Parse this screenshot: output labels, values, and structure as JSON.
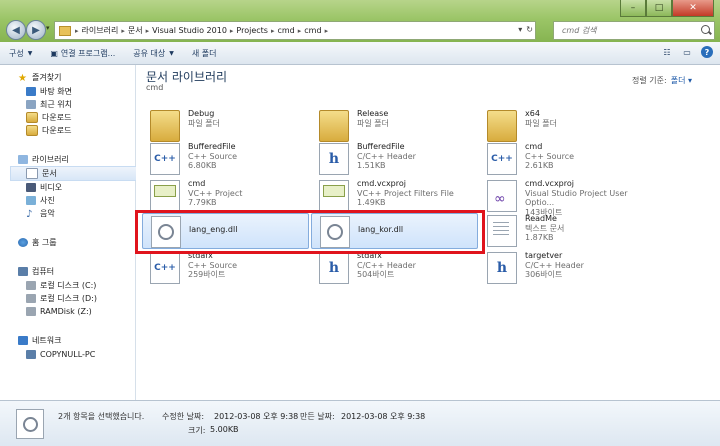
{
  "window": {
    "controls": {
      "minimize": "–",
      "maximize": "□",
      "close": "✕"
    }
  },
  "address": {
    "crumbs": [
      "라이브러리",
      "문서",
      "Visual Studio 2010",
      "Projects",
      "cmd",
      "cmd"
    ],
    "search_placeholder": "cmd 검색"
  },
  "toolbar": {
    "organize": "구성",
    "open_program": "연결 프로그램...",
    "share": "공유 대상",
    "new_folder": "새 폴더"
  },
  "sidebar": {
    "favorites": "즐겨찾기",
    "desktop": "바탕 화면",
    "recent": "최근 위치",
    "downloads1": "다운로드",
    "downloads2": "다운로드",
    "libraries": "라이브러리",
    "documents": "문서",
    "videos": "비디오",
    "pictures": "사진",
    "music": "음악",
    "homegroup": "홈 그룹",
    "computer": "컴퓨터",
    "disk_c": "로컬 디스크 (C:)",
    "disk_d": "로컬 디스크 (D:)",
    "ramdisk": "RAMDisk (Z:)",
    "network": "네트워크",
    "pc": "COPYNULL-PC"
  },
  "content": {
    "title": "문서 라이브러리",
    "subtitle": "cmd",
    "arrange_label": "정렬 기준:",
    "arrange_value": "폴더 ▾",
    "files": [
      {
        "name": "Debug",
        "type": "파일 폴더",
        "size": "",
        "icon": "folder"
      },
      {
        "name": "Release",
        "type": "파일 폴더",
        "size": "",
        "icon": "folder"
      },
      {
        "name": "x64",
        "type": "파일 폴더",
        "size": "",
        "icon": "folder"
      },
      {
        "name": "BufferedFile",
        "type": "C++ Source",
        "size": "6.80KB",
        "icon": "cpp"
      },
      {
        "name": "BufferedFile",
        "type": "C/C++ Header",
        "size": "1.51KB",
        "icon": "h"
      },
      {
        "name": "cmd",
        "type": "C++ Source",
        "size": "2.61KB",
        "icon": "cpp"
      },
      {
        "name": "cmd",
        "type": "VC++ Project",
        "size": "7.79KB",
        "icon": "proj"
      },
      {
        "name": "cmd.vcxproj",
        "type": "VC++ Project Filters File",
        "size": "1.49KB",
        "icon": "proj"
      },
      {
        "name": "cmd.vcxproj",
        "type": "Visual Studio Project User Optio...",
        "size": "143바이트",
        "icon": "vs"
      },
      {
        "name": "lang_eng.dll",
        "type": "",
        "size": "",
        "icon": "dll",
        "selected": true
      },
      {
        "name": "lang_kor.dll",
        "type": "",
        "size": "",
        "icon": "dll",
        "selected": true
      },
      {
        "name": "ReadMe",
        "type": "텍스트 문서",
        "size": "1.87KB",
        "icon": "txt"
      },
      {
        "name": "stdafx",
        "type": "C++ Source",
        "size": "259바이트",
        "icon": "cpp"
      },
      {
        "name": "stdafx",
        "type": "C/C++ Header",
        "size": "504바이트",
        "icon": "h"
      },
      {
        "name": "targetver",
        "type": "C/C++ Header",
        "size": "306바이트",
        "icon": "h"
      }
    ]
  },
  "status": {
    "selected": "2개 항목을 선택했습니다.",
    "modified_label": "수정한 날짜:",
    "modified_value": "2012-03-08 오후 9:38",
    "created_label": "만든 날짜:",
    "created_value": "2012-03-08 오후 9:38",
    "size_label": "크기:",
    "size_value": "5.00KB"
  }
}
